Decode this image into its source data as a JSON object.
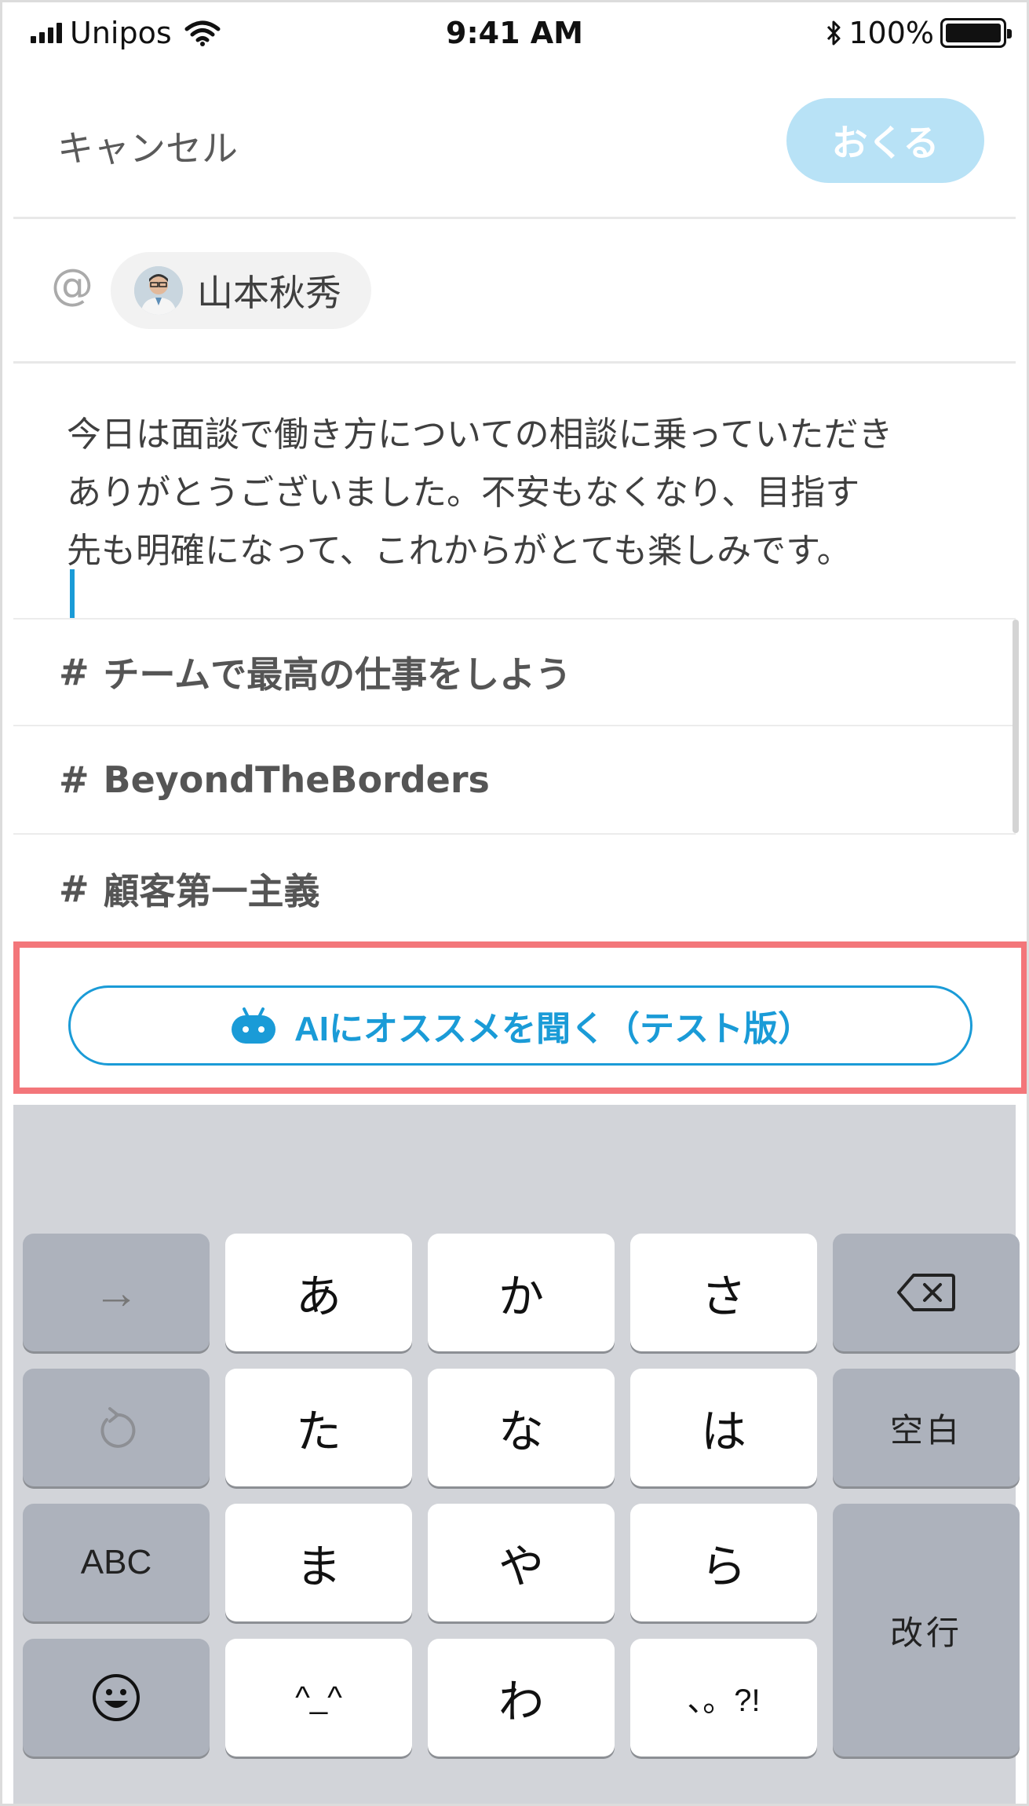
{
  "status_bar": {
    "carrier": "Unipos",
    "time": "9:41 AM",
    "battery": "100%",
    "battery_level": 1.0
  },
  "header": {
    "cancel_label": "キャンセル",
    "send_label": "おくる"
  },
  "recipient": {
    "at_symbol": "@",
    "name": "山本秋秀"
  },
  "message": {
    "line1": "今日は面談で働き方についての相談に乗っていただき",
    "line2": "ありがとうございました。不安もなくなり、目指す",
    "line3": "先も明確になって、これからがとても楽しみです。"
  },
  "hashtags": [
    {
      "hash": "#",
      "label": "チームで最高の仕事をしよう"
    },
    {
      "hash": "#",
      "label": "BeyondTheBorders"
    },
    {
      "hash": "#",
      "label": "顧客第一主義"
    }
  ],
  "ai_button": {
    "label": "AIにオススメを聞く（テスト版）",
    "icon": "robot-icon"
  },
  "colors": {
    "accent": "#1a9bd7",
    "send_disabled": "#b8e2f6",
    "highlight": "#f3767a",
    "keyboard_bg": "#d2d4d9",
    "key_dark": "#adb2bc"
  },
  "keyboard": {
    "keys": {
      "arrow": "→",
      "a": "あ",
      "ka": "か",
      "sa": "さ",
      "backspace_icon": "backspace-icon",
      "undo_icon": "undo-icon",
      "ta": "た",
      "na": "な",
      "ha": "は",
      "space": "空白",
      "abc": "ABC",
      "ma": "ま",
      "ya": "や",
      "ra": "ら",
      "enter": "改行",
      "emoji_icon": "emoji-icon",
      "kaomoji": "^_^",
      "wa": "わ",
      "punct": "、。?!"
    }
  }
}
